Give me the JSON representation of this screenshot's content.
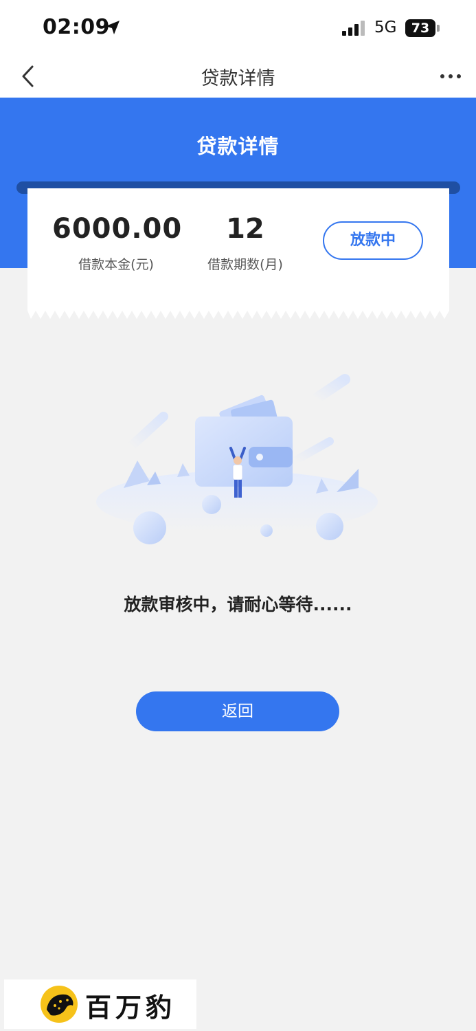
{
  "status_bar": {
    "time": "02:09",
    "network": "5G",
    "battery": "73"
  },
  "nav": {
    "title": "贷款详情"
  },
  "header": {
    "title": "贷款详情",
    "color": "#3476ef"
  },
  "loan": {
    "amount": "6000.00",
    "amount_label": "借款本金(元)",
    "term": "12",
    "term_label": "借款期数(月)",
    "status": "放款中"
  },
  "message": "放款审核中，请耐心等待......",
  "return_button": "返回",
  "watermark": {
    "brand": "百万豹"
  },
  "icons": [
    "location-arrow-icon",
    "signal-icon",
    "battery-icon",
    "back-icon",
    "more-icon",
    "wallet-illustration",
    "leopard-logo-icon"
  ]
}
